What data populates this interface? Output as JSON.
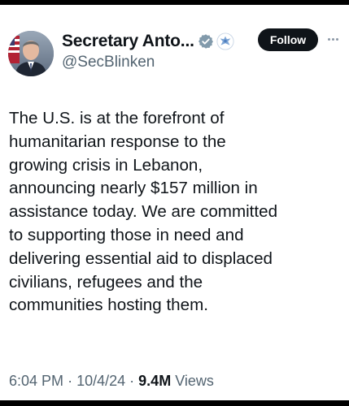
{
  "tweet": {
    "author": {
      "display_name": "Secretary Anto...",
      "handle": "@SecBlinken",
      "verified_badge": "gray-verified-badge-icon",
      "affiliate_badge": "us-department-of-state-seal-icon"
    },
    "follow_label": "Follow",
    "more_label": "···",
    "text": "The U.S. is at the forefront of\nhumanitarian response to the\ngrowing crisis in Lebanon,\nannouncing nearly $157 million in\nassistance today. We are committed\nto supporting those in need and\ndelivering essential aid to displaced\ncivilians, refugees and the\ncommunities hosting them.",
    "time": "6:04 PM",
    "separator": "·",
    "date": "10/4/24",
    "views_count": "9.4M",
    "views_label": "Views"
  },
  "colors": {
    "text_primary": "#0f1419",
    "text_secondary": "#536471",
    "follow_button_bg": "#0f1419",
    "badge_gray": "#829aab",
    "seal_blue": "#7ea6d6"
  }
}
